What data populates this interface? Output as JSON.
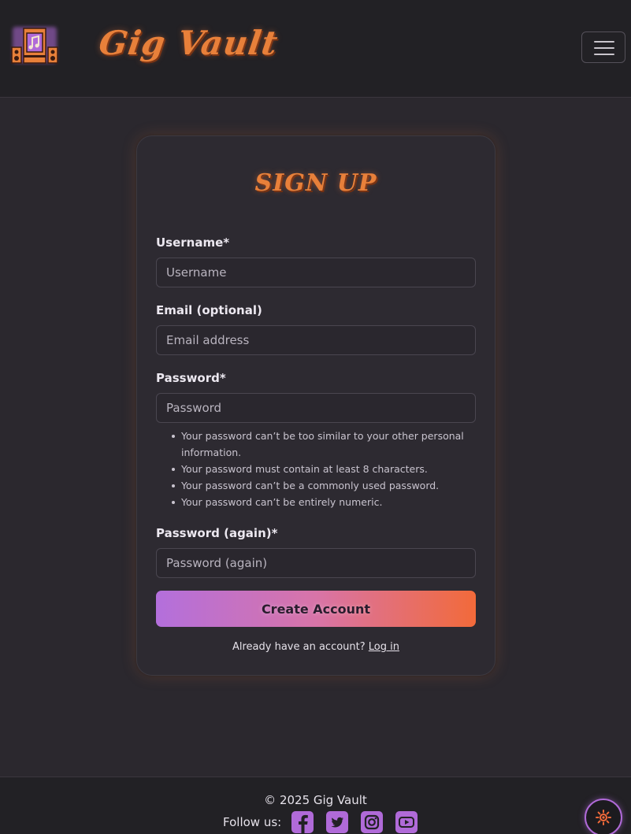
{
  "brand": {
    "name": "Gig Vault",
    "logo_icon": "speaker-music-icon",
    "accent_color": "#e8803a"
  },
  "nav": {
    "toggler_icon": "hamburger-menu-icon"
  },
  "form": {
    "title": "Sign Up",
    "username": {
      "label": "Username*",
      "placeholder": "Username",
      "value": ""
    },
    "email": {
      "label": "Email (optional)",
      "placeholder": "Email address",
      "value": ""
    },
    "password": {
      "label": "Password*",
      "placeholder": "Password",
      "value": ""
    },
    "password_help": [
      "Your password can’t be too similar to your other personal information.",
      "Your password must contain at least 8 characters.",
      "Your password can’t be a commonly used password.",
      "Your password can’t be entirely numeric."
    ],
    "password2": {
      "label": "Password (again)*",
      "placeholder": "Password (again)",
      "value": ""
    },
    "submit_label": "Create Account",
    "login_prompt": "Already have an account?",
    "login_link": "Log in"
  },
  "footer": {
    "copyright": "© 2025 Gig Vault",
    "follow_label": "Follow us:",
    "socials": [
      "facebook-icon",
      "twitter-icon",
      "instagram-icon",
      "youtube-icon"
    ]
  },
  "theme_toggle_icon": "sun-icon",
  "colors": {
    "background": "#2b282e",
    "social_icon": "#b06ad8",
    "gradient_start": "#b36fdc",
    "gradient_end": "#f26a3a"
  }
}
